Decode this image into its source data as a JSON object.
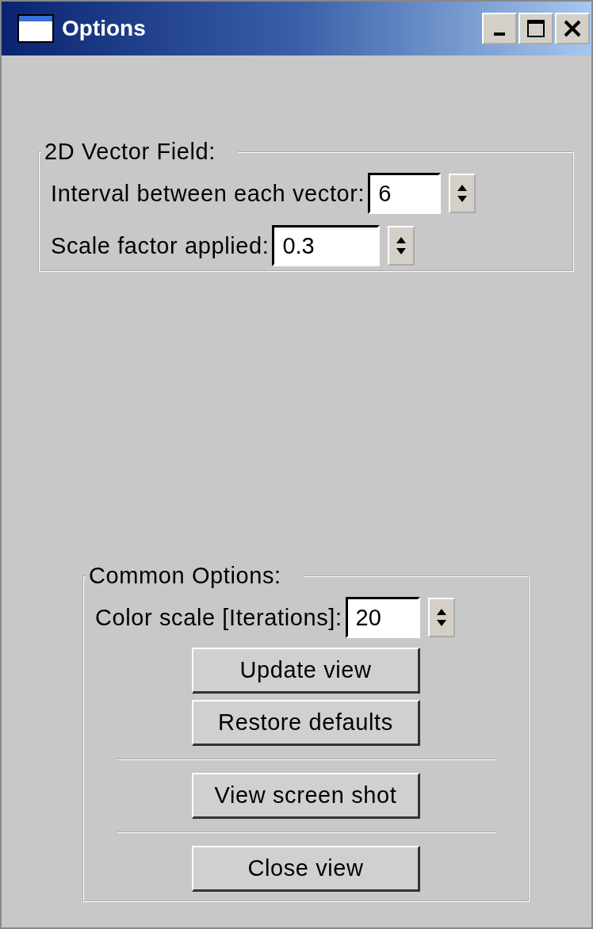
{
  "window": {
    "title": "Options"
  },
  "groups": [
    {
      "title": "2D Vector Field:",
      "items": [
        {
          "kind": "field",
          "label": "Interval between each vector:",
          "value": "6"
        },
        {
          "kind": "field",
          "label": "Scale factor applied:",
          "value": "0.3"
        }
      ]
    },
    {
      "title": "Common Options:",
      "items": [
        {
          "kind": "field",
          "label": "Color scale [Iterations]:",
          "value": "20"
        },
        {
          "kind": "button",
          "label": "Update view"
        },
        {
          "kind": "button",
          "label": "Restore defaults"
        },
        {
          "kind": "separator"
        },
        {
          "kind": "button",
          "label": "View screen shot"
        },
        {
          "kind": "separator"
        },
        {
          "kind": "button",
          "label": "Close view"
        }
      ]
    }
  ]
}
